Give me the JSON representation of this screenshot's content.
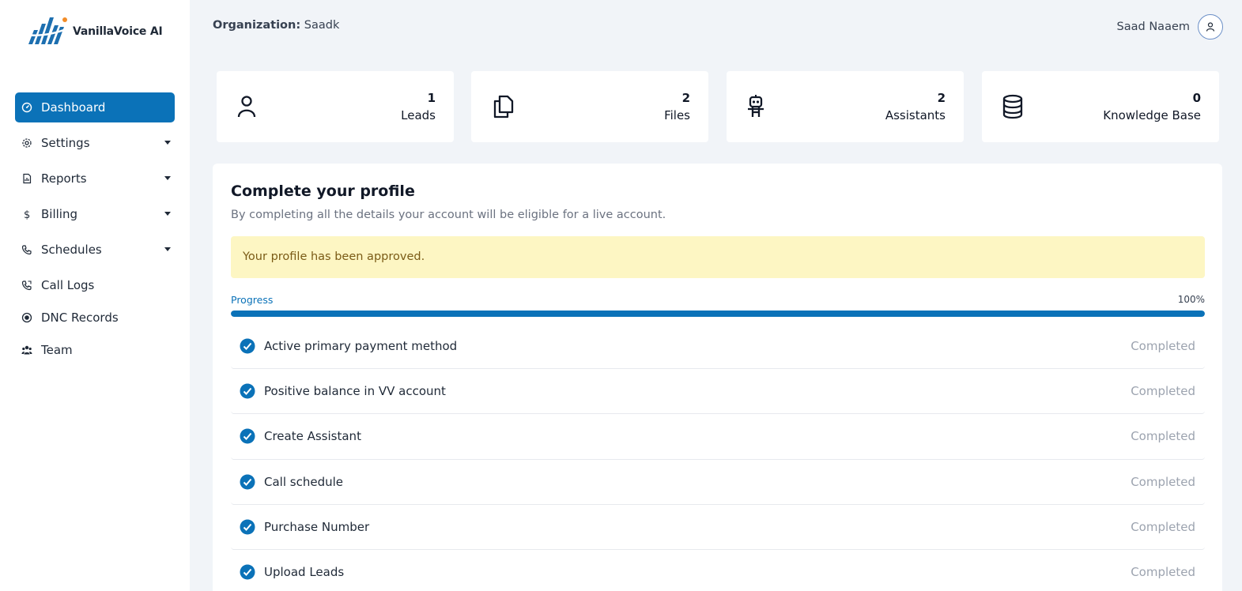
{
  "brand": {
    "name": "VanillaVoice AI",
    "accent": "#0b72b8"
  },
  "sidebar": {
    "items": [
      {
        "label": "Dashboard",
        "icon": "gauge-icon",
        "active": true,
        "dropdown": false
      },
      {
        "label": "Settings",
        "icon": "gear-icon",
        "active": false,
        "dropdown": true
      },
      {
        "label": "Reports",
        "icon": "report-icon",
        "active": false,
        "dropdown": true
      },
      {
        "label": "Billing",
        "icon": "dollar-icon",
        "active": false,
        "dropdown": true
      },
      {
        "label": "Schedules",
        "icon": "phone-icon",
        "active": false,
        "dropdown": true
      },
      {
        "label": "Call Logs",
        "icon": "phone-log-icon",
        "active": false,
        "dropdown": false
      },
      {
        "label": "DNC Records",
        "icon": "record-icon",
        "active": false,
        "dropdown": false
      },
      {
        "label": "Team",
        "icon": "team-icon",
        "active": false,
        "dropdown": false
      }
    ]
  },
  "header": {
    "org_label": "Organization:",
    "org_name": "Saadk",
    "user_name": "Saad Naaem"
  },
  "stats": [
    {
      "value": "1",
      "label": "Leads",
      "icon": "user-icon"
    },
    {
      "value": "2",
      "label": "Files",
      "icon": "files-icon"
    },
    {
      "value": "2",
      "label": "Assistants",
      "icon": "robot-icon"
    },
    {
      "value": "0",
      "label": "Knowledge Base",
      "icon": "database-icon"
    }
  ],
  "profile": {
    "title": "Complete your profile",
    "subtitle": "By completing all the details your account will be eligible for a live account.",
    "alert": "Your profile has been approved.",
    "progress_label": "Progress",
    "progress_text": "100%",
    "progress_value": 1.0,
    "tasks": [
      {
        "label": "Active primary payment method",
        "status": "Completed"
      },
      {
        "label": "Positive balance in VV account",
        "status": "Completed"
      },
      {
        "label": "Create Assistant",
        "status": "Completed"
      },
      {
        "label": "Call schedule",
        "status": "Completed"
      },
      {
        "label": "Purchase Number",
        "status": "Completed"
      },
      {
        "label": "Upload Leads",
        "status": "Completed"
      }
    ]
  }
}
